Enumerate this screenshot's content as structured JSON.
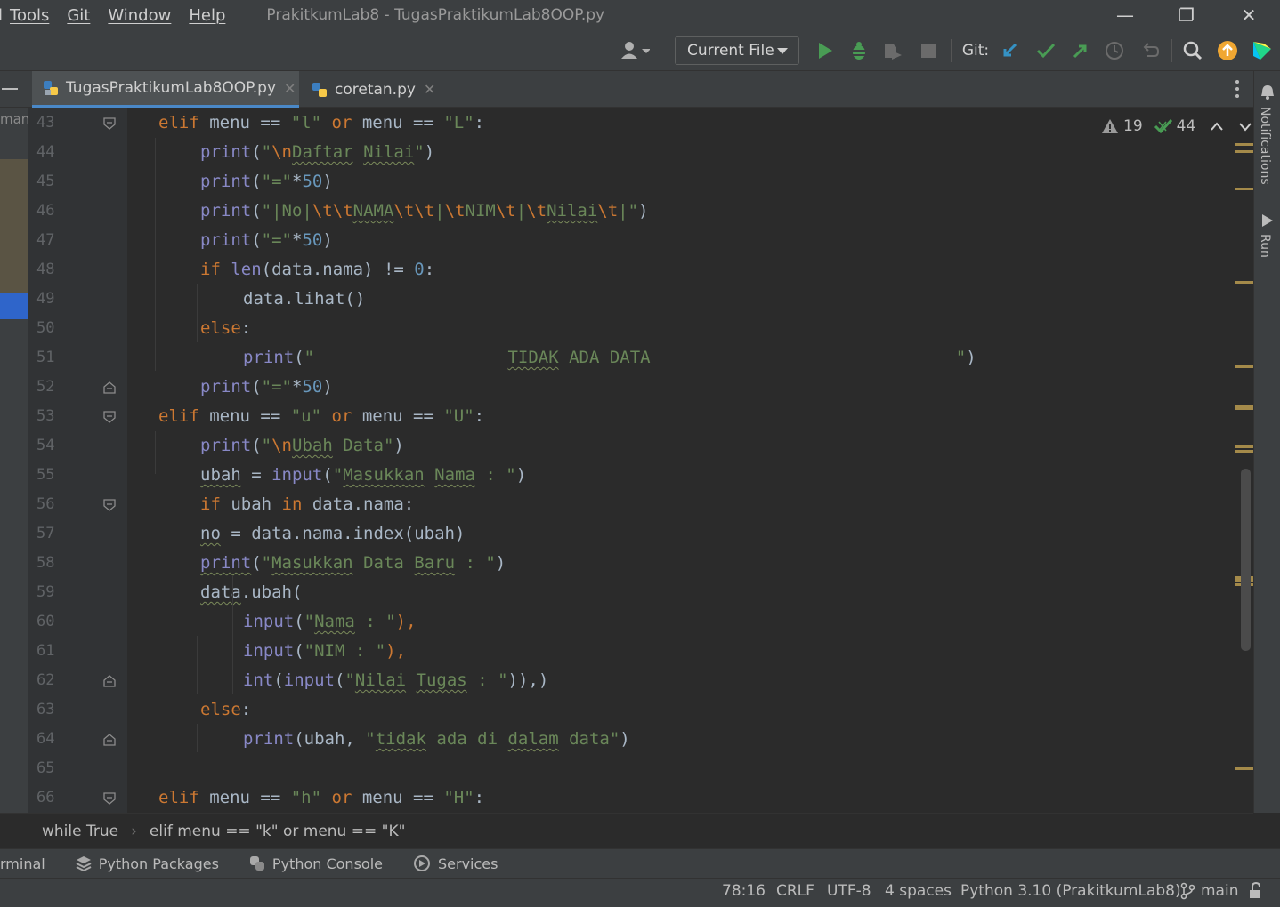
{
  "menu": {
    "edge": "l",
    "items": [
      "Tools",
      "Git",
      "Window",
      "Help"
    ]
  },
  "window": {
    "title": "PrakitkumLab8 - TugasPraktikumLab8OOP.py",
    "minimize": "—",
    "restore": "❐",
    "close": "✕"
  },
  "toolbar": {
    "run_config": "Current File",
    "git_label": "Git:",
    "colors": {
      "run": "#499c54",
      "debug": "#499c54",
      "update": "#3592c4",
      "commit": "#499c54",
      "push": "#499c54",
      "update_badge": "#f0a732"
    }
  },
  "tabs": [
    {
      "label": "TugasPraktikumLab8OOP.py",
      "active": true
    },
    {
      "label": "coretan.py",
      "active": false
    }
  ],
  "left_strip_label": "man",
  "inspection": {
    "warnings": "19",
    "ok": "44"
  },
  "right_strip": {
    "notifications": "Notifications",
    "run": "Run"
  },
  "code_lines": [
    {
      "n": "43",
      "indent": 1
    },
    {
      "n": "44",
      "indent": 2
    },
    {
      "n": "45",
      "indent": 2
    },
    {
      "n": "46",
      "indent": 2
    },
    {
      "n": "47",
      "indent": 2
    },
    {
      "n": "48",
      "indent": 2
    },
    {
      "n": "49",
      "indent": 3
    },
    {
      "n": "50",
      "indent": 2
    },
    {
      "n": "51",
      "indent": 3
    },
    {
      "n": "52",
      "indent": 2
    },
    {
      "n": "53",
      "indent": 1
    },
    {
      "n": "54",
      "indent": 2
    },
    {
      "n": "55",
      "indent": 2
    },
    {
      "n": "56",
      "indent": 2
    },
    {
      "n": "57",
      "indent": 2
    },
    {
      "n": "58",
      "indent": 2
    },
    {
      "n": "59",
      "indent": 2
    },
    {
      "n": "60",
      "indent": 3
    },
    {
      "n": "61",
      "indent": 3
    },
    {
      "n": "62",
      "indent": 3
    },
    {
      "n": "63",
      "indent": 2
    },
    {
      "n": "64",
      "indent": 3
    },
    {
      "n": "65",
      "indent": 0
    },
    {
      "n": "66",
      "indent": 1
    }
  ],
  "code_text": {
    "l43": [
      "elif",
      " menu == ",
      "\"l\"",
      " ",
      "or",
      " menu == ",
      "\"L\"",
      ":"
    ],
    "l44": [
      "print",
      "(",
      "\"",
      "\\n",
      "Daftar",
      " ",
      "Nilai",
      "\"",
      ")"
    ],
    "l45": [
      "print",
      "(",
      "\"=\"",
      "*",
      "50",
      ")"
    ],
    "l46": [
      "print",
      "(",
      "\"|No|",
      "\\t\\t",
      "NAMA",
      "\\t\\t",
      "|",
      "\\t",
      "NIM",
      "\\t",
      "|",
      "\\t",
      "Nilai",
      "\\t",
      "|\"",
      ")"
    ],
    "l47": [
      "print",
      "(",
      "\"=\"",
      "*",
      "50",
      ")"
    ],
    "l48": [
      "if",
      " ",
      "len",
      "(data.nama) != ",
      "0",
      ":"
    ],
    "l49": [
      "data.lihat()"
    ],
    "l50": [
      "else",
      ":"
    ],
    "l51": [
      "print",
      "(",
      "\"                   ",
      "TIDAK",
      " ADA DATA                              \"",
      ")"
    ],
    "l52": [
      "print",
      "(",
      "\"=\"",
      "*",
      "50",
      ")"
    ],
    "l53": [
      "elif",
      " menu == ",
      "\"u\"",
      " ",
      "or",
      " menu == ",
      "\"U\"",
      ":"
    ],
    "l54": [
      "print",
      "(",
      "\"",
      "\\n",
      "Ubah",
      " Data\"",
      ")"
    ],
    "l55": [
      "ubah",
      " = ",
      "input",
      "(",
      "\"",
      "Masukkan",
      " ",
      "Nama",
      " : \"",
      ")"
    ],
    "l56": [
      "if",
      " ubah ",
      "in",
      " data.nama:"
    ],
    "l57": [
      "no",
      " = data.nama.index(ubah)"
    ],
    "l58": [
      "print",
      "(",
      "\"",
      "Masukkan",
      " Data ",
      "Baru",
      " : \"",
      ")"
    ],
    "l59": [
      "data",
      ".ubah("
    ],
    "l60": [
      "input",
      "(",
      "\"",
      "Nama",
      " : \"",
      "),"
    ],
    "l61": [
      "input",
      "(",
      "\"NIM : \"",
      "),"
    ],
    "l62": [
      "int",
      "(",
      "input",
      "(",
      "\"",
      "Nilai",
      " ",
      "Tugas",
      " : \"",
      ")),)"
    ],
    "l63": [
      "else",
      ":"
    ],
    "l64": [
      "print",
      "(ubah, ",
      "\"",
      "tidak",
      " ada di ",
      "dalam",
      " data\"",
      ")"
    ],
    "l65": [
      ""
    ],
    "l66": [
      "elif",
      " menu == ",
      "\"h\"",
      " ",
      "or",
      " menu == ",
      "\"H\"",
      ":"
    ]
  },
  "breadcrumb": [
    "while True",
    "elif menu == \"k\" or menu == \"K\""
  ],
  "tool_windows": [
    {
      "label": "rminal",
      "icon": "terminal-icon"
    },
    {
      "label": "Python Packages",
      "icon": "layers-icon"
    },
    {
      "label": "Python Console",
      "icon": "python-icon"
    },
    {
      "label": "Services",
      "icon": "services-icon"
    }
  ],
  "status": {
    "position": "78:16",
    "line_sep": "CRLF",
    "encoding": "UTF-8",
    "indent": "4 spaces",
    "interpreter": "Python 3.10 (PrakitkumLab8)",
    "branch": "main"
  }
}
